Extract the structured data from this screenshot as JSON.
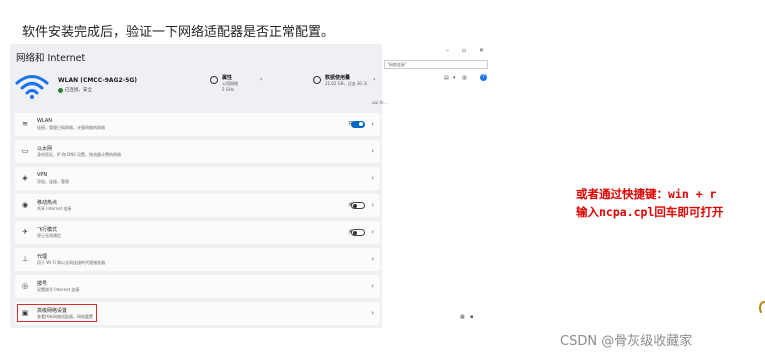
{
  "intro_text": "软件安装完成后，验证一下网络适配器是否正常配置。",
  "settings": {
    "title": "网络和 Internet",
    "network": {
      "name": "WLAN (CMCC-9AG2-5G)",
      "status": "已连接，安全"
    },
    "cards": [
      {
        "icon": "info-icon",
        "title": "属性",
        "line1": "公用网络",
        "line2": "5 GHz"
      },
      {
        "icon": "data-usage-icon",
        "title": "数据使用量",
        "line1": "21.02 GB，过去 30 天",
        "line2": ""
      }
    ],
    "rows": [
      {
        "icon": "wifi-icon",
        "title": "WLAN",
        "subtitle": "连接，管理已知网络，计量网络的网络",
        "toggle_label": "开",
        "toggle_state": "on"
      },
      {
        "icon": "ethernet-icon",
        "title": "以太网",
        "subtitle": "身份验证，IP 和 DNS 设置，按流量计费的网络",
        "toggle_label": "",
        "toggle_state": ""
      },
      {
        "icon": "vpn-icon",
        "title": "VPN",
        "subtitle": "添加，连接，管理",
        "toggle_label": "",
        "toggle_state": ""
      },
      {
        "icon": "hotspot-icon",
        "title": "移动热点",
        "subtitle": "共享 Internet 连接",
        "toggle_label": "关",
        "toggle_state": "off"
      },
      {
        "icon": "airplane-icon",
        "title": "飞行模式",
        "subtitle": "停止无线通信",
        "toggle_label": "关",
        "toggle_state": "off"
      },
      {
        "icon": "proxy-icon",
        "title": "代理",
        "subtitle": "用于 Wi-Fi 和以太网连接的代理服务器",
        "toggle_label": "",
        "toggle_state": ""
      },
      {
        "icon": "dialup-icon",
        "title": "拨号",
        "subtitle": "设置拨号 Internet 连接",
        "toggle_label": "",
        "toggle_state": ""
      },
      {
        "icon": "advanced-network-icon",
        "title": "高级网络设置",
        "subtitle": "查看所有网络适配器，网络重置",
        "toggle_label": "",
        "toggle_state": ""
      }
    ]
  },
  "background_window": {
    "address_text": "\"网络连接\"",
    "side_text": "ual Ar..."
  },
  "note": {
    "line1": "或者通过快捷键：win + r",
    "line2": "输入ncpa.cpl回车即可打开"
  },
  "watermark": "CSDN @骨灰级收藏家",
  "colors": {
    "accent": "#0067c0",
    "highlight": "#d32f2f",
    "note": "#e00000"
  }
}
